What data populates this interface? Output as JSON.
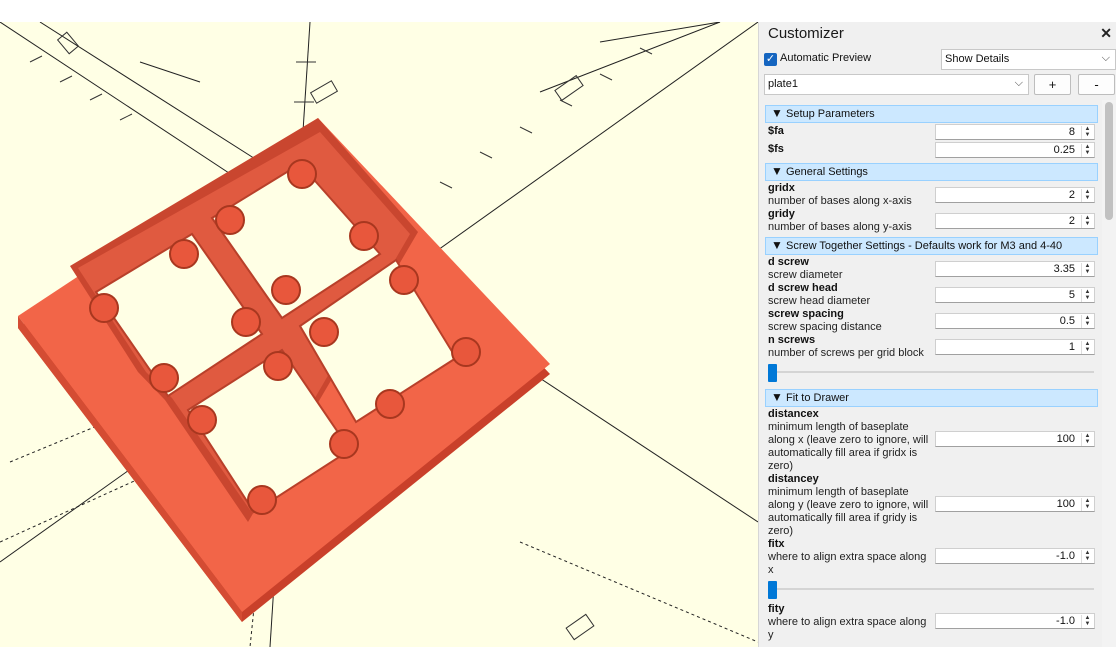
{
  "panel": {
    "title": "Customizer",
    "close": "✕",
    "auto_preview_label": "Automatic Preview",
    "details_mode": "Show Details",
    "preset": "plate1",
    "add_preset": "+",
    "remove_preset": "-"
  },
  "groups": {
    "setup": "Setup Parameters",
    "general": "General Settings",
    "screw": "Screw Together Settings - Defaults work for M3 and 4-40",
    "fit": "Fit to Drawer"
  },
  "params": {
    "fa": {
      "name": "$fa",
      "value": "8"
    },
    "fs": {
      "name": "$fs",
      "value": "0.25"
    },
    "gridx": {
      "name": "gridx",
      "desc": "number of bases along x-axis",
      "value": "2"
    },
    "gridy": {
      "name": "gridy",
      "desc": "number of bases along y-axis",
      "value": "2"
    },
    "d_screw": {
      "name": "d screw",
      "desc": "screw diameter",
      "value": "3.35"
    },
    "d_screw_head": {
      "name": "d screw head",
      "desc": "screw head diameter",
      "value": "5"
    },
    "screw_spacing": {
      "name": "screw spacing",
      "desc": "screw spacing distance",
      "value": "0.5"
    },
    "n_screws": {
      "name": "n screws",
      "desc": "number of screws per grid block",
      "value": "1",
      "slider_fraction": 0
    },
    "distancex": {
      "name": "distancex",
      "desc": "minimum length of baseplate along x (leave zero to ignore, will automatically fill area if gridx is zero)",
      "value": "100"
    },
    "distancey": {
      "name": "distancey",
      "desc": "minimum length of baseplate along y (leave zero to ignore, will automatically fill area if gridy is zero)",
      "value": "100"
    },
    "fitx": {
      "name": "fitx",
      "desc": "where to align extra space along x",
      "value": "-1.0",
      "slider_fraction": 0
    },
    "fity": {
      "name": "fity",
      "desc": "where to align extra space along y",
      "value": "-1.0"
    }
  },
  "colors": {
    "viewport_bg": "#ffffe5",
    "model": "#f26548",
    "group_header": "#cce8ff",
    "accent": "#0078d7"
  },
  "icons": [
    "checkbox-checked-icon",
    "chevron-down-icon",
    "expand-triangle-icon",
    "spin-arrows-icon",
    "close-icon"
  ]
}
